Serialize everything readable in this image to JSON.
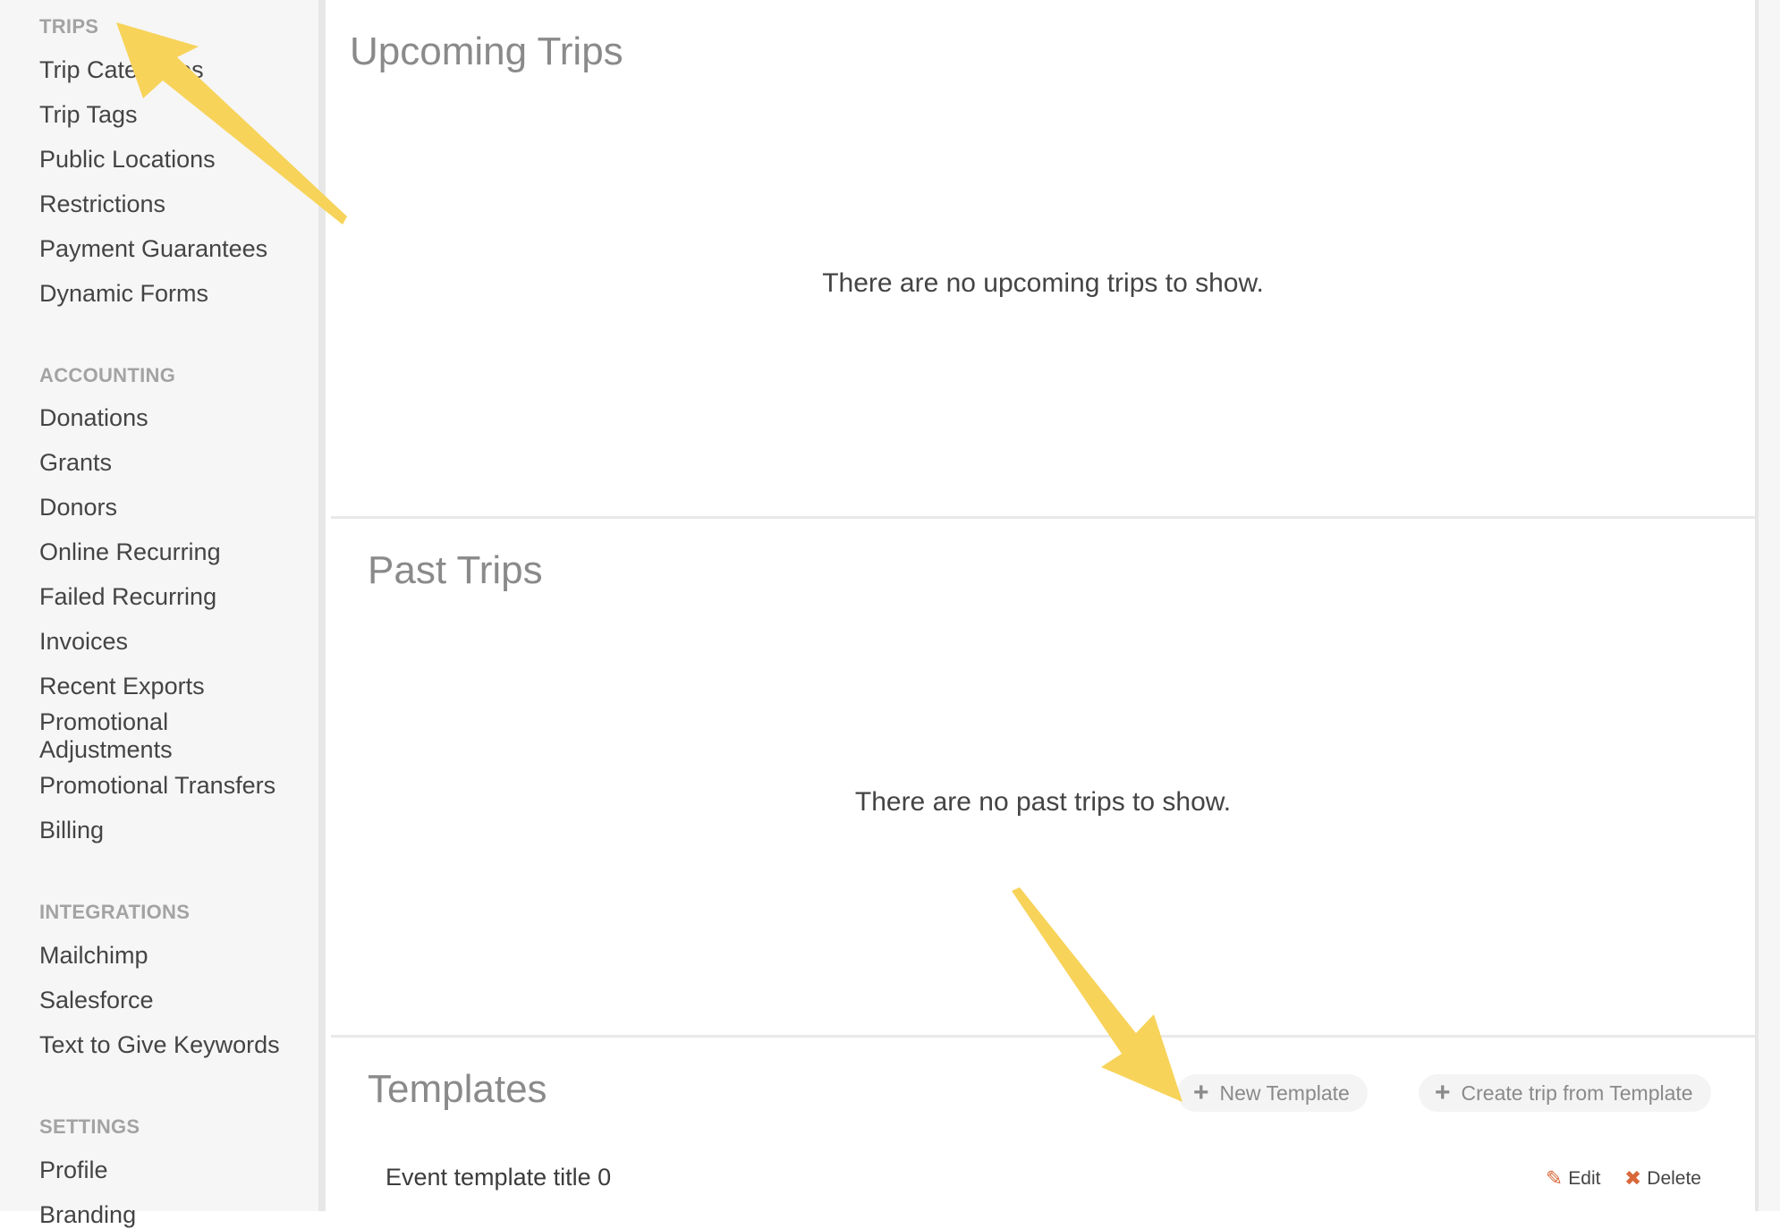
{
  "sidebar": {
    "sections": [
      {
        "heading": "TRIPS",
        "items": [
          "Trip Categories",
          "Trip Tags",
          "Public Locations",
          "Restrictions",
          "Payment Guarantees",
          "Dynamic Forms"
        ]
      },
      {
        "heading": "ACCOUNTING",
        "items": [
          "Donations",
          "Grants",
          "Donors",
          "Online Recurring",
          "Failed Recurring",
          "Invoices",
          "Recent Exports",
          "Promotional Adjustments",
          "Promotional Transfers",
          "Billing"
        ]
      },
      {
        "heading": "INTEGRATIONS",
        "items": [
          "Mailchimp",
          "Salesforce",
          "Text to Give Keywords"
        ]
      },
      {
        "heading": "SETTINGS",
        "items": [
          "Profile",
          "Branding"
        ]
      }
    ]
  },
  "upcoming": {
    "title": "Upcoming Trips",
    "empty_message": "There are no upcoming trips to show."
  },
  "past": {
    "title": "Past Trips",
    "empty_message": "There are no past trips to show."
  },
  "templates": {
    "title": "Templates",
    "new_template_label": "New Template",
    "create_trip_label": "Create trip from Template",
    "rows": [
      {
        "title": "Event template title 0",
        "edit_label": "Edit",
        "delete_label": "Delete"
      }
    ]
  },
  "icons": {
    "plus": "plus-icon",
    "edit": "pencil-icon",
    "delete": "x-icon"
  },
  "colors": {
    "annotation_arrow": "#f7d35a",
    "action_icon": "#d8683a",
    "sidebar_bg": "#f6f6f6"
  }
}
